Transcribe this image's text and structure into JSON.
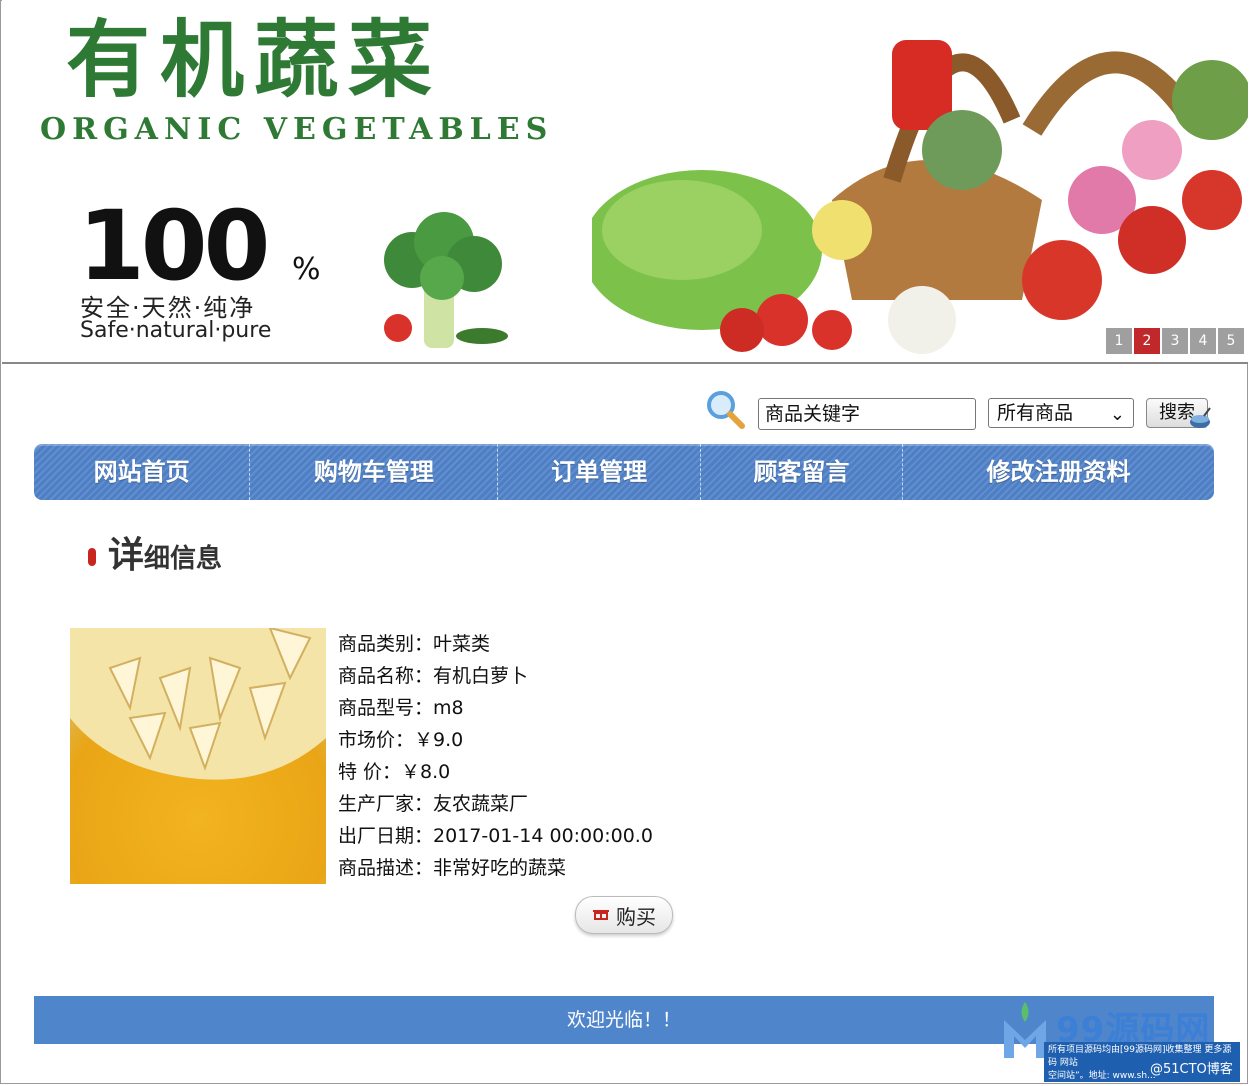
{
  "banner": {
    "logo_cn": "有机蔬菜",
    "logo_en": "ORGANIC VEGETABLES",
    "hundred": "100",
    "percent": "%",
    "slogan_cn": "安全·天然·纯净",
    "slogan_en": "Safe·natural·pure",
    "pager": [
      "1",
      "2",
      "3",
      "4",
      "5"
    ],
    "pager_active": 2
  },
  "search": {
    "keyword_value": "商品关键字",
    "category_selected": "所有商品",
    "button_label": "搜索"
  },
  "nav": {
    "items": [
      {
        "label": "网站首页"
      },
      {
        "label": "购物车管理"
      },
      {
        "label": "订单管理"
      },
      {
        "label": "顾客留言"
      },
      {
        "label": "修改注册资料"
      }
    ]
  },
  "detail": {
    "title_first": "详",
    "title_rest": "细信息",
    "fields": [
      {
        "label": "商品类别：",
        "value": "叶菜类"
      },
      {
        "label": "商品名称：",
        "value": "有机白萝卜"
      },
      {
        "label": "商品型号：",
        "value": "m8"
      },
      {
        "label": "市场价：",
        "value": "￥9.0"
      },
      {
        "label": "特 价：",
        "value": "￥8.0"
      },
      {
        "label": "生产厂家：",
        "value": "友农蔬菜厂"
      },
      {
        "label": "出厂日期：",
        "value": "2017-01-14 00:00:00.0"
      },
      {
        "label": "商品描述：",
        "value": "非常好吃的蔬菜"
      }
    ],
    "buy_label": "购买"
  },
  "footer": {
    "text": "欢迎光临！！"
  },
  "watermark": {
    "brand": "99源码网",
    "line1": "所有项目源码均由[99源码网]收集整理 更多源码 网站",
    "line2": "空间站”。地址: www.sh...",
    "tag": "@51CTO博客"
  },
  "colors": {
    "brand_green": "#2e7a35",
    "nav_blue": "#4f7ec2",
    "footer_blue": "#4f85cb",
    "accent_red": "#c8251e"
  }
}
